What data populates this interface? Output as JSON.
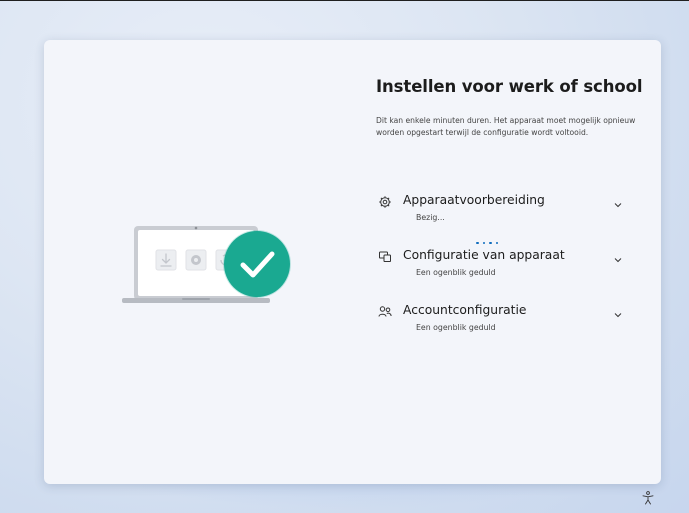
{
  "setup": {
    "title": "Instellen voor werk of school",
    "description": "Dit kan enkele minuten duren. Het apparaat moet mogelijk opnieuw worden opgestart terwijl de configuratie wordt voltooid.",
    "steps": [
      {
        "label": "Apparaatvoorbereiding",
        "status": "Bezig...",
        "icon": "gear-icon",
        "in_progress": true
      },
      {
        "label": "Configuratie van apparaat",
        "status": "Een ogenblik geduld",
        "icon": "devices-icon",
        "in_progress": false
      },
      {
        "label": "Accountconfiguratie",
        "status": "Een ogenblik geduld",
        "icon": "people-icon",
        "in_progress": false
      }
    ]
  },
  "colors": {
    "accent": "#0f6cbd",
    "check_badge": "#1fb39a",
    "card": "#f3f5fa"
  },
  "footer": {
    "accessibility_icon": "accessibility-icon"
  }
}
